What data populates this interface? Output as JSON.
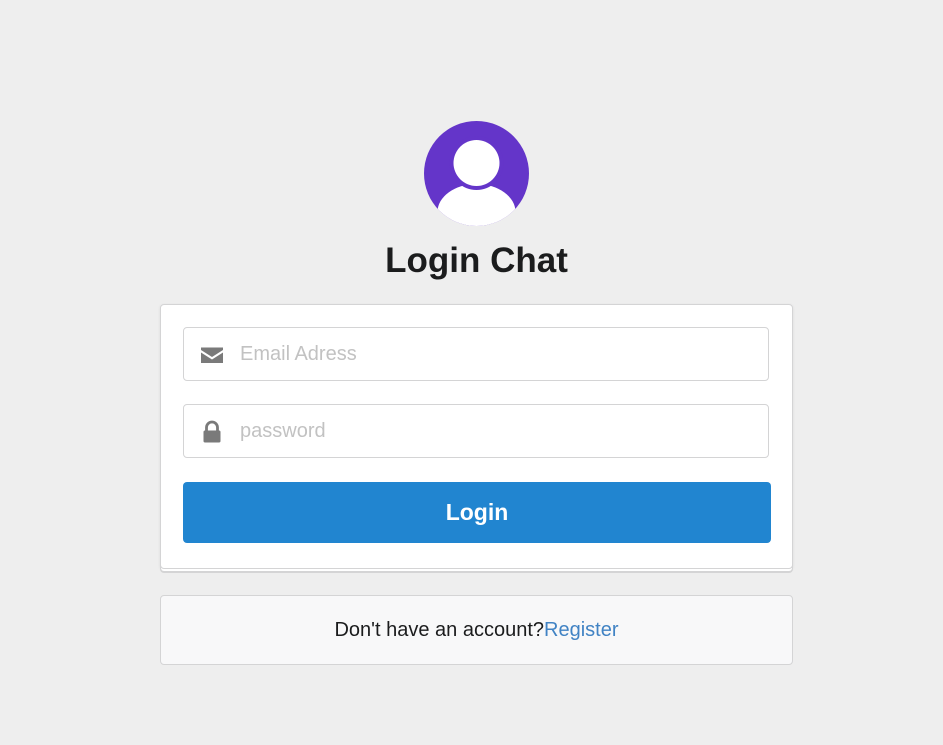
{
  "header": {
    "title": "Login Chat",
    "avatar_icon": "user-icon",
    "avatar_color": "#6435c9"
  },
  "form": {
    "email": {
      "icon": "envelope-icon",
      "value": "",
      "placeholder": "Email Adress"
    },
    "password": {
      "icon": "lock-icon",
      "value": "",
      "placeholder": "password"
    },
    "login_label": "Login",
    "login_color": "#2185d0"
  },
  "footer": {
    "prompt": "Don't have an account?",
    "register_label": "Register",
    "link_color": "#4183c4"
  }
}
